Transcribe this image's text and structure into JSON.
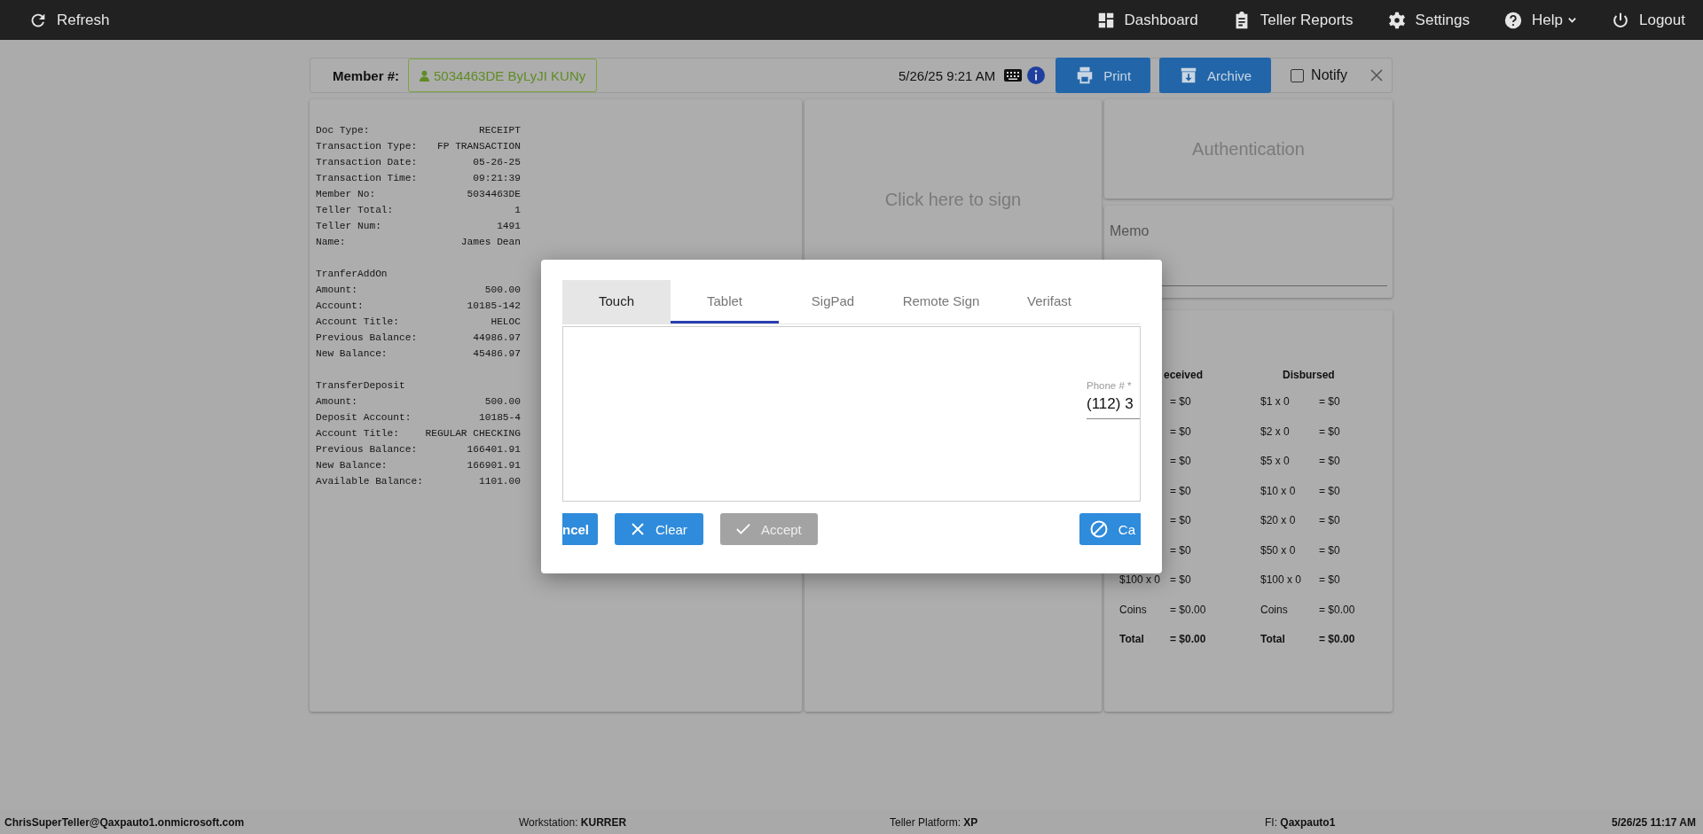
{
  "top_bar": {
    "left": {
      "label": "Refresh"
    },
    "items": [
      {
        "label": "Dashboard",
        "menu": false
      },
      {
        "label": "Teller Reports",
        "menu": false
      },
      {
        "label": "Settings",
        "menu": false
      },
      {
        "label": "Help",
        "menu": true
      },
      {
        "label": "Logout",
        "menu": false
      }
    ]
  },
  "member_bar": {
    "label": "Member #:",
    "member": "5034463DE ByLyJI KUNy",
    "datetime": "5/26/25 9:21 AM",
    "buttons": [
      {
        "label": "Print"
      },
      {
        "label": "Archive"
      }
    ],
    "notify": {
      "label": "Notify",
      "checked": false
    }
  },
  "receipt": {
    "sections": [
      {
        "lines": [
          {
            "label": "Doc Type:",
            "value": "RECEIPT"
          },
          {
            "label": "Transaction Type:",
            "value": "FP TRANSACTION"
          },
          {
            "label": "Transaction Date:",
            "value": "05-26-25"
          },
          {
            "label": "Transaction Time:",
            "value": "09:21:39"
          },
          {
            "label": "Member No:",
            "value": "5034463DE"
          },
          {
            "label": "Teller Total:",
            "value": "1"
          },
          {
            "label": "Teller Num:",
            "value": "1491"
          },
          {
            "label": "Name:",
            "value": "James Dean"
          }
        ]
      },
      {
        "title": "TranferAddOn",
        "lines": [
          {
            "label": "Amount:",
            "value": "500.00"
          },
          {
            "label": "Account:",
            "value": "10185-142"
          },
          {
            "label": "Account Title:",
            "value": "HELOC"
          },
          {
            "label": "Previous Balance:",
            "value": "44986.97"
          },
          {
            "label": "New Balance:",
            "value": "45486.97"
          }
        ]
      },
      {
        "title": "TransferDeposit",
        "lines": [
          {
            "label": "Amount:",
            "value": "500.00"
          },
          {
            "label": "Deposit Account:",
            "value": "10185-4"
          },
          {
            "label": "Account Title:",
            "value": "REGULAR CHECKING"
          },
          {
            "label": "Previous Balance:",
            "value": "166401.91"
          },
          {
            "label": "New Balance:",
            "value": "166901.91"
          },
          {
            "label": "Available Balance:",
            "value": "1101.00"
          }
        ]
      }
    ]
  },
  "signature_panel": {
    "prompt": "Click here to sign"
  },
  "authentication": {
    "title": "Authentication"
  },
  "memo": {
    "label": "Memo"
  },
  "cash": {
    "received_heading": "eceived",
    "disbursed_heading": "Disbursed",
    "rows": [
      {
        "received_label": "",
        "received_value": "= $0",
        "disbursed_label": "$1 x 0",
        "disbursed_value": "= $0",
        "kind": "plain"
      },
      {
        "received_label": "",
        "received_value": "= $0",
        "disbursed_label": "$2 x 0",
        "disbursed_value": "= $0",
        "kind": "plain"
      },
      {
        "received_label": "",
        "received_value": "= $0",
        "disbursed_label": "$5 x 0",
        "disbursed_value": "= $0",
        "kind": "plain"
      },
      {
        "received_label": "",
        "received_value": "= $0",
        "disbursed_label": "$10 x 0",
        "disbursed_value": "= $0",
        "kind": "plain"
      },
      {
        "received_label": "",
        "received_value": "= $0",
        "disbursed_label": "$20 x 0",
        "disbursed_value": "= $0",
        "kind": "plain"
      },
      {
        "received_label": "",
        "received_value": "= $0",
        "disbursed_label": "$50 x 0",
        "disbursed_value": "= $0",
        "kind": "plain"
      },
      {
        "received_label": "$100 x 0",
        "received_value": "= $0",
        "disbursed_label": "$100 x 0",
        "disbursed_value": "= $0",
        "kind": "plain"
      },
      {
        "received_label": "Coins",
        "received_value": "= $0.00",
        "disbursed_label": "Coins",
        "disbursed_value": "= $0.00",
        "kind": "plain"
      },
      {
        "received_label": "Total",
        "received_value": "= $0.00",
        "disbursed_label": "Total",
        "disbursed_value": "= $0.00",
        "kind": "total"
      }
    ]
  },
  "signature_dialog": {
    "tabs": [
      {
        "label": "Touch",
        "selected": false,
        "hovered": true
      },
      {
        "label": "Tablet",
        "selected": true,
        "hovered": false
      },
      {
        "label": "SigPad",
        "selected": false,
        "hovered": false
      },
      {
        "label": "Remote Sign",
        "selected": false,
        "hovered": false
      },
      {
        "label": "Verifast",
        "selected": false,
        "hovered": false
      }
    ],
    "phone_field": {
      "label": "Phone # *",
      "value": "(112) 3"
    },
    "buttons": [
      {
        "label": "ncel",
        "kind": "cut-left",
        "disabled": false
      },
      {
        "label": "Clear",
        "kind": "clear",
        "disabled": false
      },
      {
        "label": "Accept",
        "kind": "accept",
        "disabled": true
      },
      {
        "label": "Ca",
        "kind": "cut-right",
        "disabled": false
      }
    ]
  },
  "status_bar": [
    "**ChrisSuperTeller@Qaxpauto1.onmicrosoft.com**",
    "Workstation: **KURRER**",
    "Teller Platform: **XP**",
    "FI: **Qaxpauto1**",
    "**5/26/25 11:17 AM**"
  ]
}
